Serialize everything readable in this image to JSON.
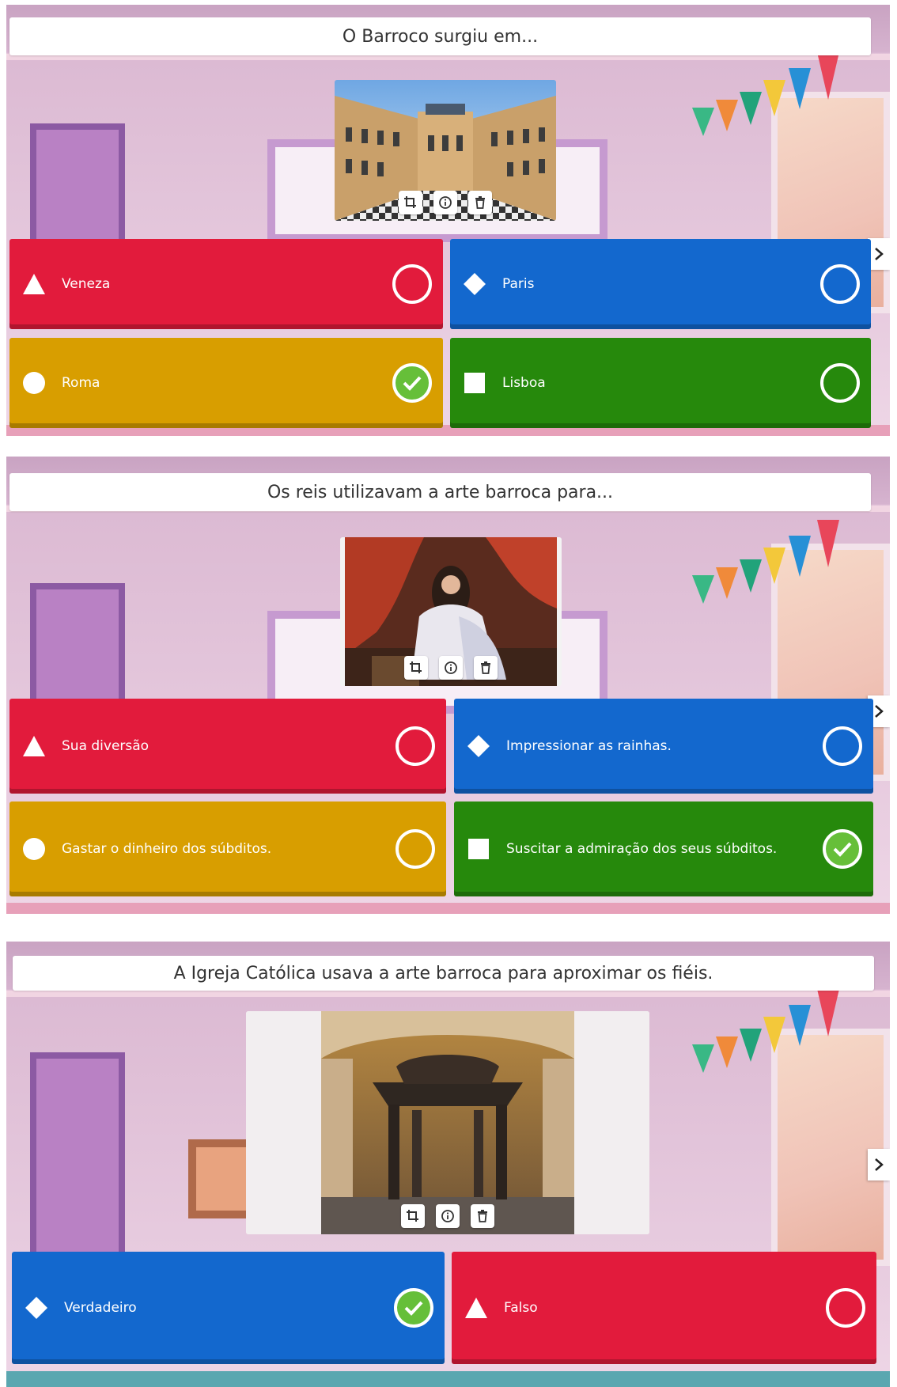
{
  "questions": [
    {
      "title": "O Barroco surgiu em...",
      "image_icon": "palace-photo",
      "answers": [
        {
          "label": "Veneza",
          "color": "#e21b3c",
          "shape": "triangle",
          "correct": false
        },
        {
          "label": "Paris",
          "color": "#1368ce",
          "shape": "diamond",
          "correct": false
        },
        {
          "label": "Roma",
          "color": "#d89e00",
          "shape": "circle",
          "correct": true
        },
        {
          "label": "Lisboa",
          "color": "#26890c",
          "shape": "square",
          "correct": false
        }
      ]
    },
    {
      "title": "Os reis utilizavam a arte barroca para...",
      "image_icon": "king-portrait-photo",
      "answers": [
        {
          "label": "Sua diversão",
          "color": "#e21b3c",
          "shape": "triangle",
          "correct": false
        },
        {
          "label": "Impressionar as rainhas.",
          "color": "#1368ce",
          "shape": "diamond",
          "correct": false
        },
        {
          "label": "Gastar o dinheiro dos súbditos.",
          "color": "#d89e00",
          "shape": "circle",
          "correct": false
        },
        {
          "label": "Suscitar a admiração dos seus súbditos.",
          "color": "#26890c",
          "shape": "square",
          "correct": true
        }
      ]
    },
    {
      "title": "A Igreja Católica usava a arte barroca para aproximar os fiéis.",
      "image_icon": "baroque-baldachin-photo",
      "answers": [
        {
          "label": "Verdadeiro",
          "color": "#1368ce",
          "shape": "diamond",
          "correct": true
        },
        {
          "label": "Falso",
          "color": "#e21b3c",
          "shape": "triangle",
          "correct": false
        }
      ]
    }
  ],
  "icons": {
    "image_tools": [
      "crop-icon",
      "info-icon",
      "delete-icon"
    ],
    "next": "chevron-right-icon",
    "correct_mark": "check-circle-icon",
    "unselected_mark": "empty-circle-icon"
  }
}
